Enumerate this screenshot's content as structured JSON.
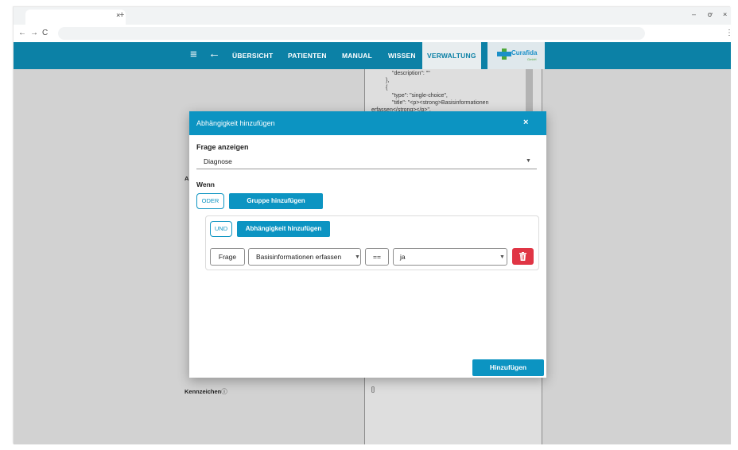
{
  "browser": {
    "tab_close": "×",
    "tab_new": "+",
    "back": "←",
    "forward": "→",
    "reload": "C",
    "minimize": "–",
    "restore": "ơ",
    "close": "×",
    "menu": "⋮"
  },
  "appbar": {
    "nav": [
      "ÜBERSICHT",
      "PATIENTEN",
      "MANUAL",
      "WISSEN",
      "VERWALTUNG"
    ],
    "active_index": 4,
    "logo_text": "Curafida",
    "logo_sub": "GmbH"
  },
  "background": {
    "json_lines": [
      "\"description\": \"\"",
      "},",
      "{",
      "\"type\": \"single-choice\",",
      "\"title\": \"<p><strong>Basisinformationen",
      "erfassen</strong></p>\","
    ],
    "kennzeichen_label": "Kennzeichen",
    "info_glyph": "ⓘ",
    "a_letter": "A",
    "bottom_json": "[]"
  },
  "dialog": {
    "title": "Abhängigkeit hinzufügen",
    "close_glyph": "×",
    "frage_label": "Frage anzeigen",
    "frage_value": "Diagnose",
    "wenn_label": "Wenn",
    "oder_button": "ODER",
    "add_group_button": "Gruppe hinzufügen",
    "und_button": "UND",
    "add_dependency_button": "Abhängigkeit hinzufügen",
    "condition": {
      "type": "Frage",
      "question": "Basisinformationen erfassen",
      "operator": "==",
      "value": "ja"
    },
    "submit_button": "Hinzufügen"
  },
  "colors": {
    "primary": "#0c94c2",
    "appbar": "#0c81a6",
    "danger": "#e03545"
  }
}
